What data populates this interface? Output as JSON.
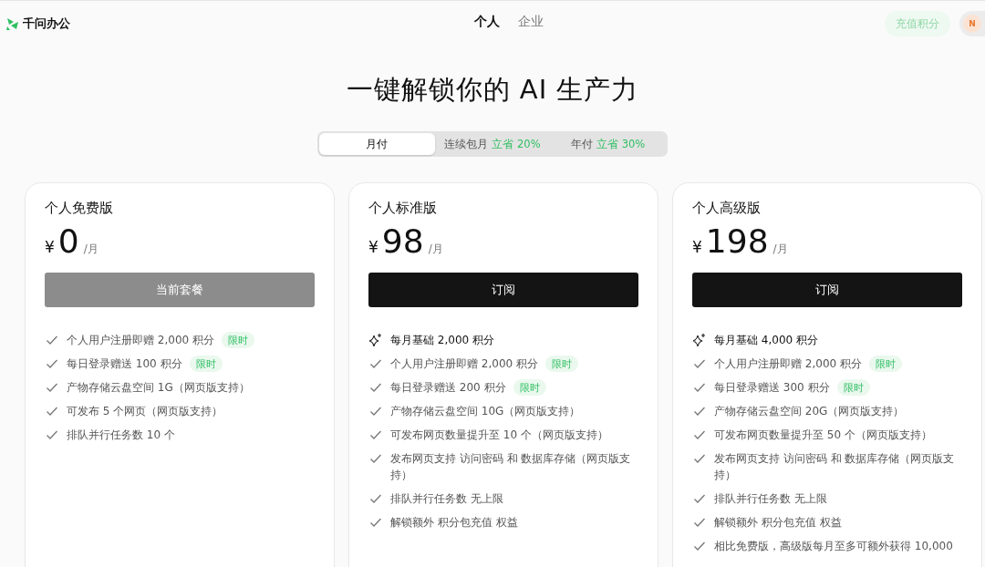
{
  "header": {
    "logo": "千问办公",
    "nav": [
      {
        "label": "个人",
        "selected": true
      },
      {
        "label": "企业",
        "selected": false
      }
    ],
    "recharge": "充值积分",
    "avatar": "N"
  },
  "headline": "一键解锁你的 AI 生产力",
  "billing_tabs": [
    {
      "label": "月付",
      "selected": true
    },
    {
      "label": "连续包月",
      "save": "立省 20%",
      "selected": false
    },
    {
      "label": "年付",
      "save": "立省 30%",
      "selected": false
    }
  ],
  "plans": [
    {
      "name": "个人免费版",
      "currency": "¥",
      "price": "0",
      "unit": "/月",
      "button": {
        "label": "当前套餐",
        "kind": "current"
      },
      "features": [
        {
          "kind": "check",
          "text": "个人用户注册即赠 2,000 积分",
          "badge": "限时"
        },
        {
          "kind": "check",
          "text": "每日登录赠送 100 积分",
          "badge": "限时"
        },
        {
          "kind": "check",
          "text": "产物存储云盘空间 1G（网页版支持）"
        },
        {
          "kind": "check",
          "text": "可发布 5 个网页（网页版支持）"
        },
        {
          "kind": "check",
          "text": "排队并行任务数 10 个"
        }
      ]
    },
    {
      "name": "个人标准版",
      "currency": "¥",
      "price": "98",
      "unit": "/月",
      "button": {
        "label": "订阅",
        "kind": "subscribe"
      },
      "features": [
        {
          "kind": "base",
          "text": "每月基础 2,000 积分"
        },
        {
          "kind": "check",
          "text": "个人用户注册即赠 2,000 积分",
          "badge": "限时"
        },
        {
          "kind": "check",
          "text": "每日登录赠送 200 积分",
          "badge": "限时"
        },
        {
          "kind": "check",
          "text": "产物存储云盘空间 10G（网页版支持）"
        },
        {
          "kind": "check",
          "text": "可发布网页数量提升至 10 个（网页版支持）"
        },
        {
          "kind": "check",
          "text": "发布网页支持 访问密码 和 数据库存储（网页版支持）"
        },
        {
          "kind": "check",
          "text": "排队并行任务数 无上限"
        },
        {
          "kind": "check",
          "text": "解锁额外 积分包充值 权益"
        }
      ]
    },
    {
      "name": "个人高级版",
      "currency": "¥",
      "price": "198",
      "unit": "/月",
      "button": {
        "label": "订阅",
        "kind": "subscribe"
      },
      "features": [
        {
          "kind": "base",
          "text": "每月基础 4,000 积分"
        },
        {
          "kind": "check",
          "text": "个人用户注册即赠 2,000 积分",
          "badge": "限时"
        },
        {
          "kind": "check",
          "text": "每日登录赠送 300 积分",
          "badge": "限时"
        },
        {
          "kind": "check",
          "text": "产物存储云盘空间 20G（网页版支持）"
        },
        {
          "kind": "check",
          "text": "可发布网页数量提升至 50 个（网页版支持）"
        },
        {
          "kind": "check",
          "text": "发布网页支持 访问密码 和 数据库存储（网页版支持）"
        },
        {
          "kind": "check",
          "text": "排队并行任务数 无上限"
        },
        {
          "kind": "check",
          "text": "解锁额外 积分包充值 权益"
        },
        {
          "kind": "check",
          "text": "相比免费版，高级版每月至多可额外获得 10,000"
        }
      ]
    }
  ]
}
